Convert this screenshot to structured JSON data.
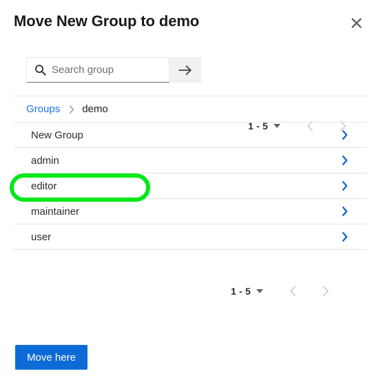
{
  "dialog": {
    "title": "Move New Group to demo",
    "close_icon": "close-icon"
  },
  "search": {
    "placeholder": "Search group",
    "value": "",
    "icon": "search-icon",
    "submit_icon": "arrow-right-icon"
  },
  "paginator_top": {
    "range": "1 - 5",
    "caret_icon": "chevron-down-icon",
    "prev_icon": "chevron-left-icon",
    "next_icon": "chevron-right-icon"
  },
  "paginator_bottom": {
    "range": "1 - 5",
    "caret_icon": "chevron-down-icon",
    "prev_icon": "chevron-left-icon",
    "next_icon": "chevron-right-icon"
  },
  "breadcrumb": {
    "root": "Groups",
    "separator_icon": "chevron-right-icon",
    "current": "demo"
  },
  "rows": [
    {
      "label": "New Group",
      "chevron_icon": "chevron-right-icon"
    },
    {
      "label": "admin",
      "chevron_icon": "chevron-right-icon"
    },
    {
      "label": "editor",
      "chevron_icon": "chevron-right-icon"
    },
    {
      "label": "maintainer",
      "chevron_icon": "chevron-right-icon"
    },
    {
      "label": "user",
      "chevron_icon": "chevron-right-icon"
    }
  ],
  "footer": {
    "move_here_label": "Move here"
  },
  "annotation": {
    "highlight_target": "editor",
    "highlight_color": "#00e819"
  },
  "colors": {
    "link": "#1a73e8",
    "chevron": "#0d65d0",
    "primary_button": "#0d6bd8",
    "separator": "#e4e4e4",
    "search_button_bg": "#f1f1f1"
  }
}
